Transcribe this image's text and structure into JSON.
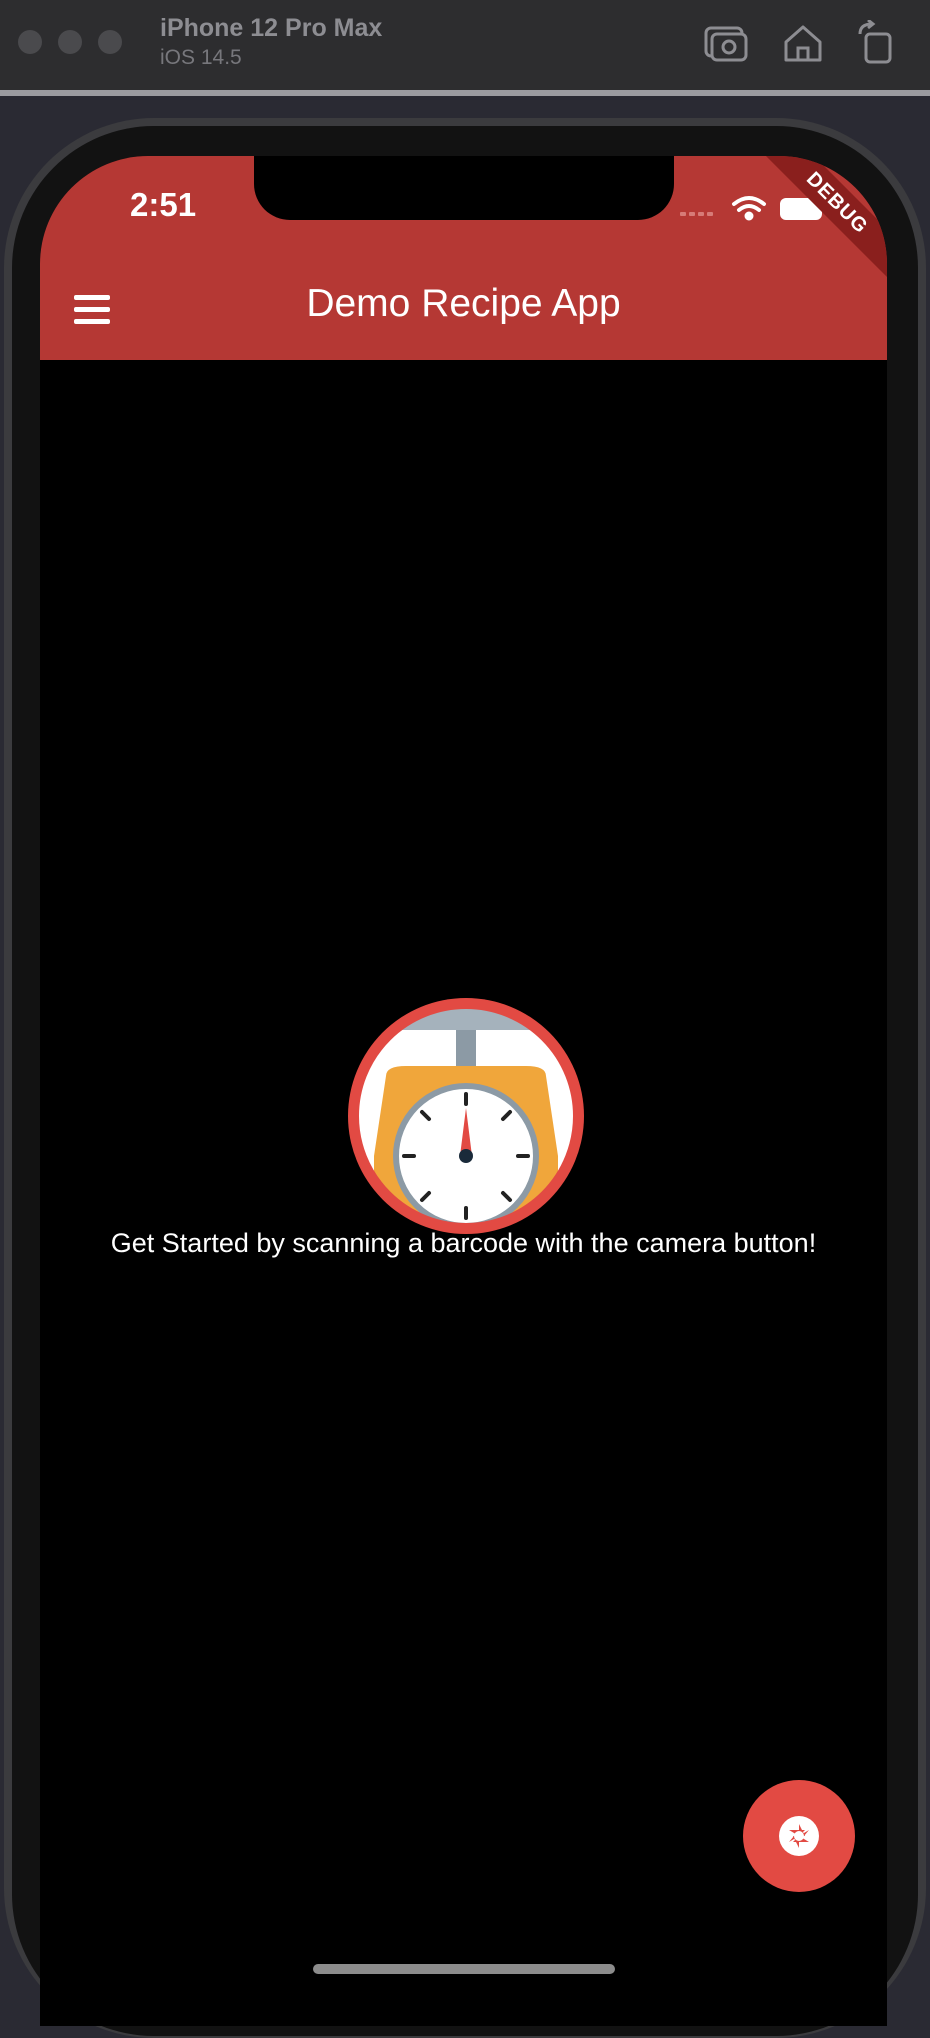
{
  "simulator": {
    "device_name": "iPhone 12 Pro Max",
    "os_version": "iOS 14.5",
    "buttons": [
      "screenshot-icon",
      "home-icon",
      "rotate-icon"
    ]
  },
  "status_bar": {
    "time": "2:51",
    "debug_label": "DEBUG"
  },
  "app_bar": {
    "title": "Demo Recipe App",
    "menu_icon": "hamburger-menu-icon",
    "color": "#b53834"
  },
  "main": {
    "logo_icon": "kitchen-scale-icon",
    "prompt_text": "Get Started by scanning a barcode with the camera button!"
  },
  "fab": {
    "icon": "camera-shutter-icon",
    "color": "#e24a43"
  }
}
